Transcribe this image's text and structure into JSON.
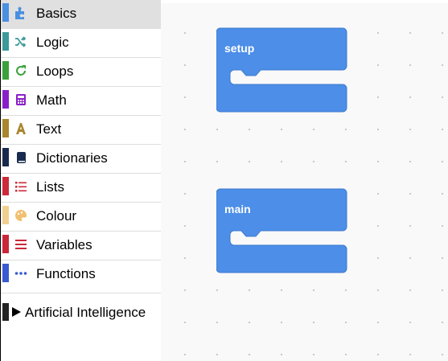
{
  "toolbox": {
    "categories": [
      {
        "label": "Basics",
        "color": "#4a90e2",
        "icon": "puzzle-icon"
      },
      {
        "label": "Logic",
        "color": "#3c9a9a",
        "icon": "shuffle-icon"
      },
      {
        "label": "Loops",
        "color": "#3aa23a",
        "icon": "refresh-icon"
      },
      {
        "label": "Math",
        "color": "#8a1fc9",
        "icon": "calculator-icon"
      },
      {
        "label": "Text",
        "color": "#a8862d",
        "icon": "text-a-icon"
      },
      {
        "label": "Dictionaries",
        "color": "#1a2a4d",
        "icon": "book-icon"
      },
      {
        "label": "Lists",
        "color": "#cc2a3a",
        "icon": "list-icon"
      },
      {
        "label": "Colour",
        "color": "#f0d090",
        "icon": "palette-icon"
      },
      {
        "label": "Variables",
        "color": "#c8283a",
        "icon": "bars-icon"
      },
      {
        "label": "Functions",
        "color": "#3a5ad0",
        "icon": "dots-icon"
      }
    ],
    "ai_category": {
      "label": "Artificial Intelligence"
    }
  },
  "workspace": {
    "blocks": [
      {
        "label": "setup",
        "color": "#4c8ee8"
      },
      {
        "label": "main",
        "color": "#4c8ee8"
      }
    ]
  }
}
